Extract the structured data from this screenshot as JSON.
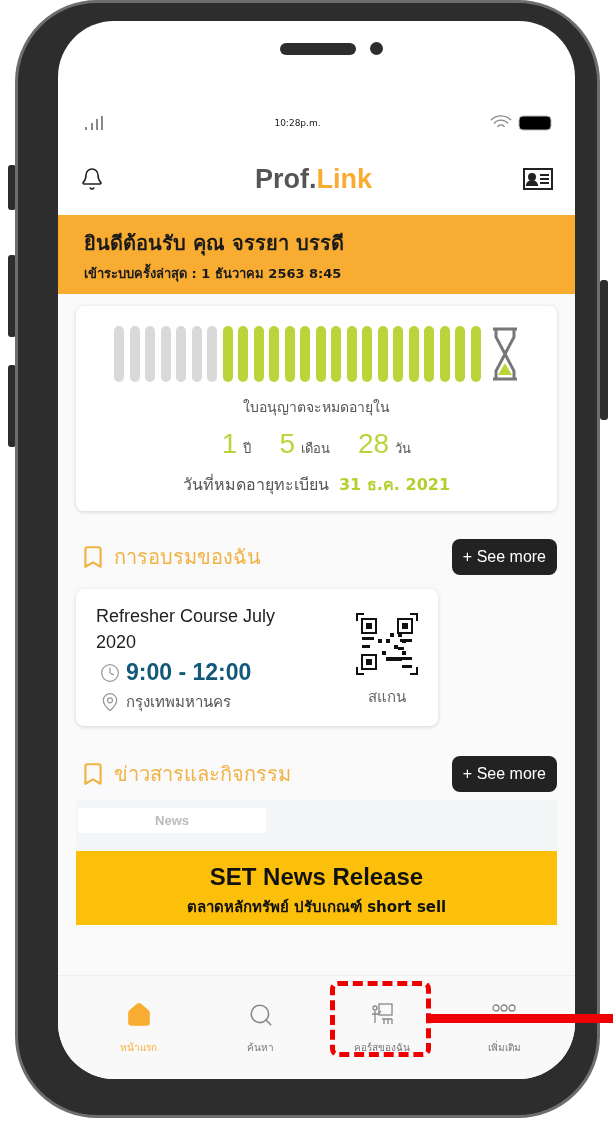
{
  "status_bar": {
    "time": "10:28p.m."
  },
  "header": {
    "logo_left": "Prof.",
    "logo_right": "Link"
  },
  "welcome": {
    "title": "ยินดีต้อนรับ คุณ จรรยา บรรดี",
    "last_login": "เข้าระบบครั้งล่าสุด : 1 ธันวาคม 2563 8:45"
  },
  "license": {
    "level": 0.71,
    "caption": "ใบอนุญาตจะหมดอายุใน",
    "remaining": [
      {
        "value": "1",
        "unit": "ปี"
      },
      {
        "value": "5",
        "unit": "เดือน"
      },
      {
        "value": "28",
        "unit": "วัน"
      }
    ],
    "expiry_label": "วันที่หมดอายุทะเบียน",
    "expiry_date": "31 ธ.ค. 2021"
  },
  "training": {
    "title": "การอบรมของฉัน",
    "see_more": "+ See more",
    "course": {
      "name": "Refresher Course July 2020",
      "time": "9:00 - 12:00",
      "place": "กรุงเทพมหานคร",
      "scan": "สแกน"
    }
  },
  "news": {
    "title": "ข่าวสารและกิจกรรม",
    "see_more": "+ See more",
    "tab": "News",
    "headline": "SET News Release",
    "subline": "ตลาดหลักทรัพย์ ปรับเกณฑ์ short sell"
  },
  "tab_bar": [
    {
      "kind": "home",
      "label": "หน้าแรก",
      "selected": true
    },
    {
      "kind": "search",
      "label": "ค้นหา",
      "selected": false
    },
    {
      "kind": "course",
      "label": "คอร์สของฉัน",
      "selected": false
    },
    {
      "kind": "more",
      "label": "เพิ่มเติม",
      "selected": false
    }
  ]
}
